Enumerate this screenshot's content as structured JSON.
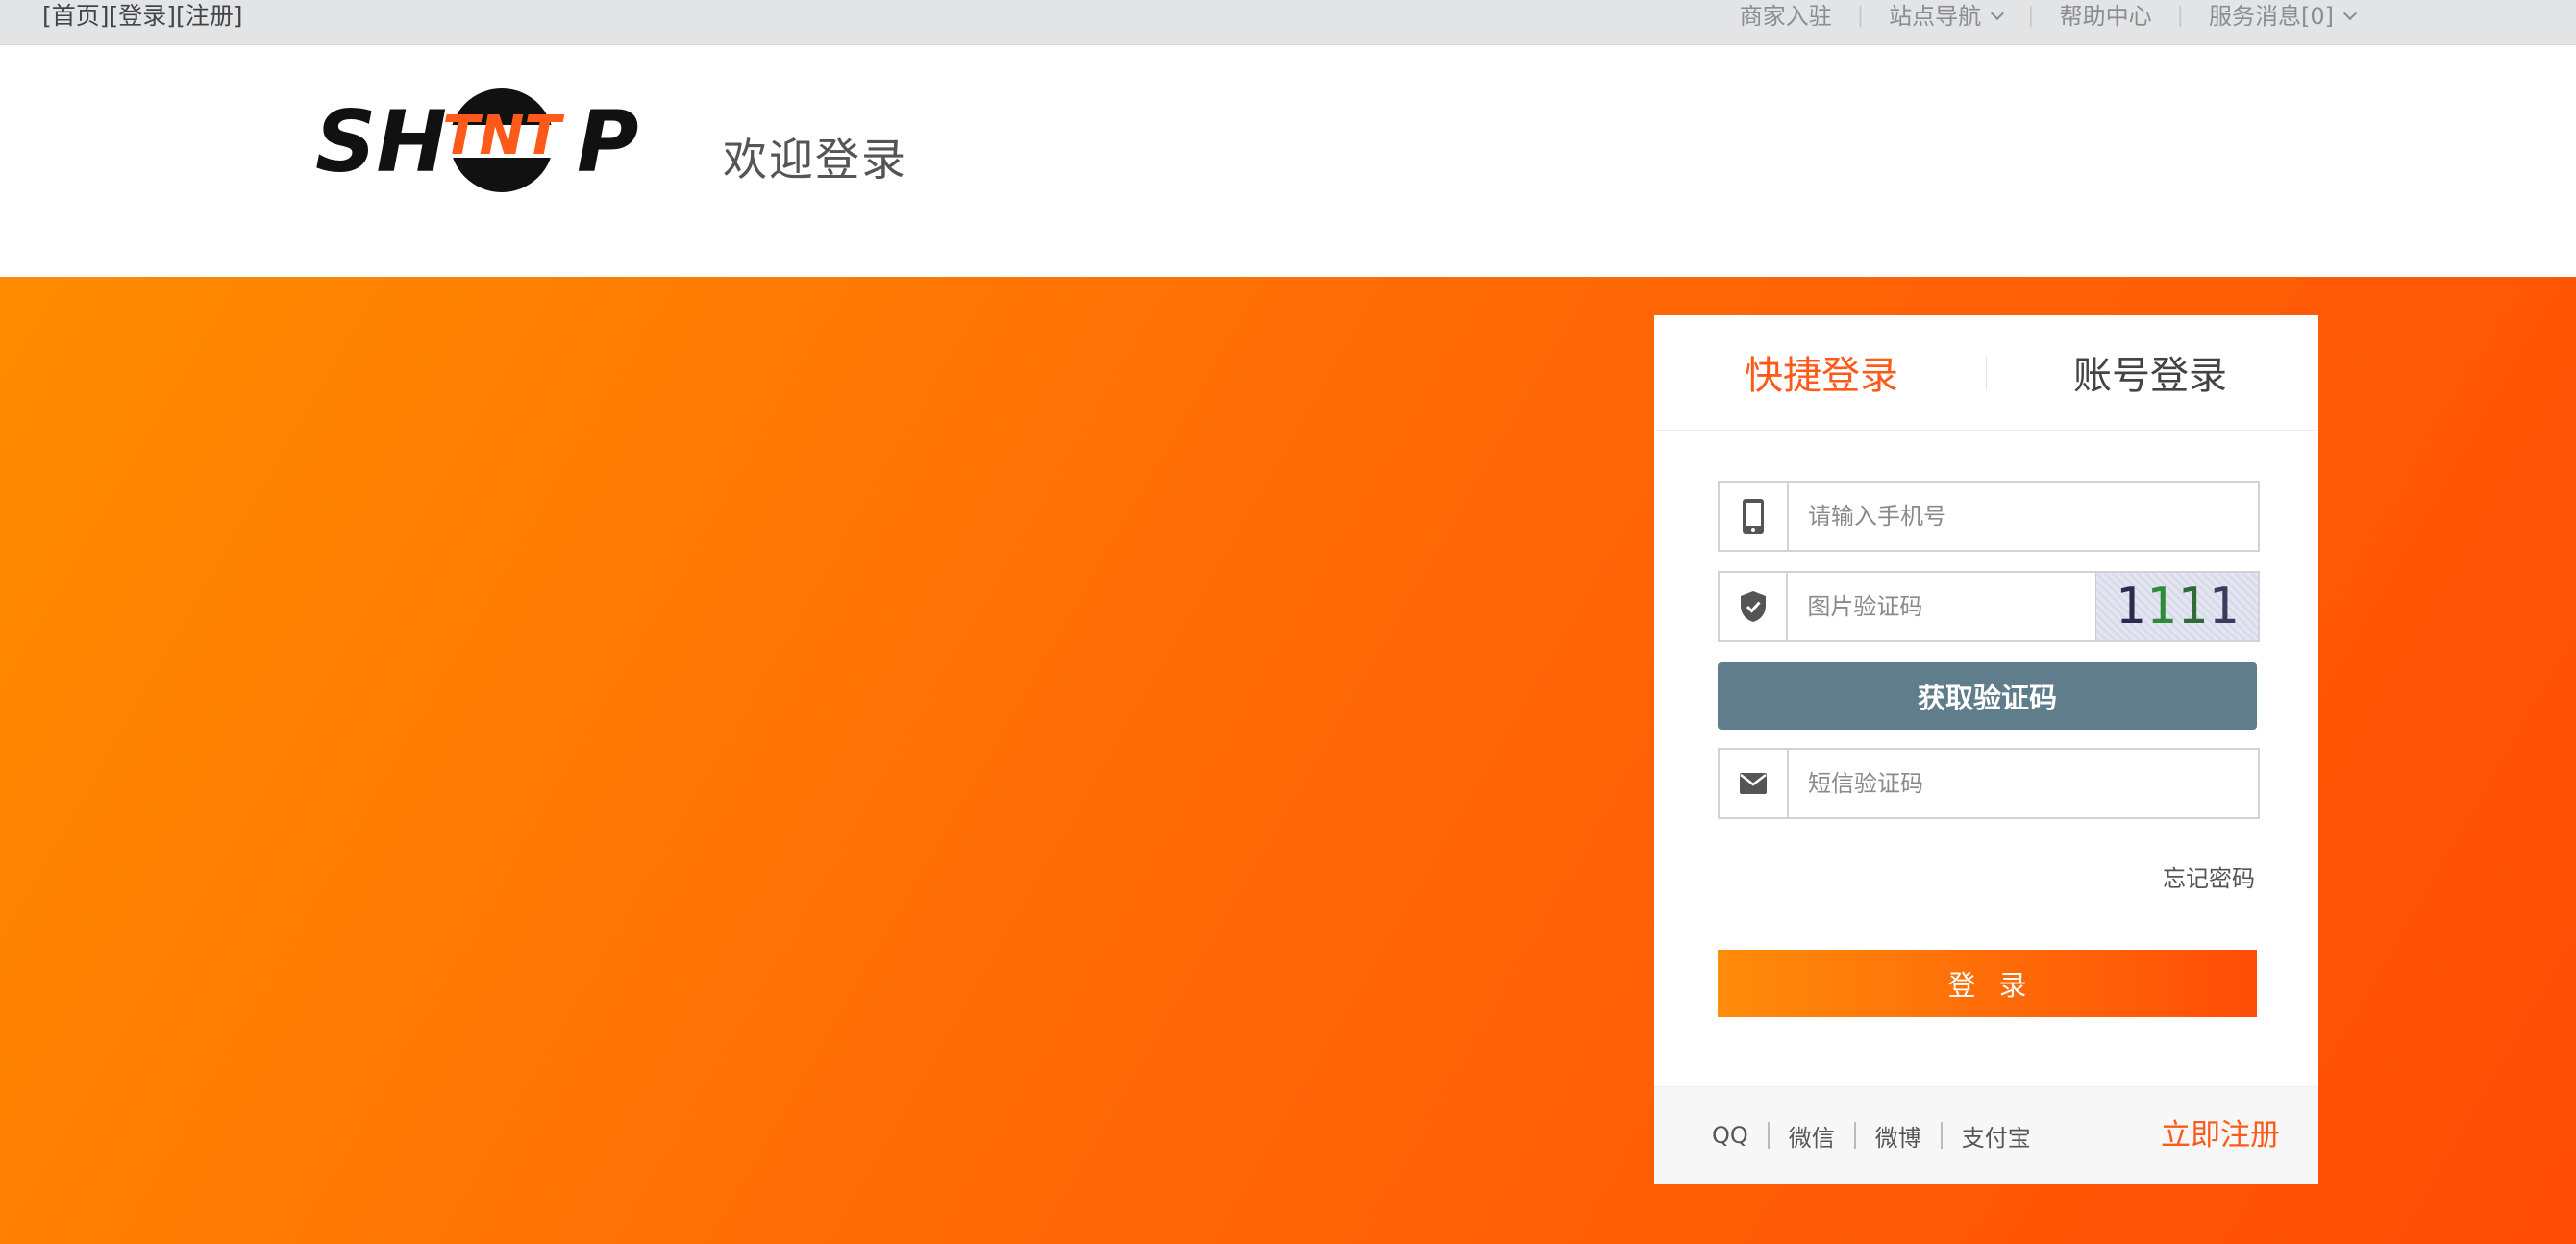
{
  "topbar": {
    "links": [
      "[首页]",
      "[登录]",
      "[注册]"
    ],
    "right": {
      "merchant": "商家入驻",
      "site_nav": "站点导航",
      "help": "帮助中心",
      "messages": "服务消息[0]"
    }
  },
  "header": {
    "logo_text_left": "SH",
    "logo_text_mid": "TNT",
    "logo_text_right": "P",
    "welcome": "欢迎登录"
  },
  "login": {
    "tabs": [
      "快捷登录",
      "账号登录"
    ],
    "phone_placeholder": "请输入手机号",
    "captcha_placeholder": "图片验证码",
    "captcha_text": [
      "1",
      "1",
      "1",
      "1"
    ],
    "get_code_label": "获取验证码",
    "sms_placeholder": "短信验证码",
    "forgot_label": "忘记密码",
    "login_label": "登录",
    "socials": [
      "QQ",
      "微信",
      "微博",
      "支付宝"
    ],
    "register_label": "立即注册"
  },
  "colors": {
    "accent": "#ff5a1a",
    "gradient_start": "#ff8c00",
    "gradient_end": "#ff4c06",
    "button_gray": "#607d8b"
  }
}
